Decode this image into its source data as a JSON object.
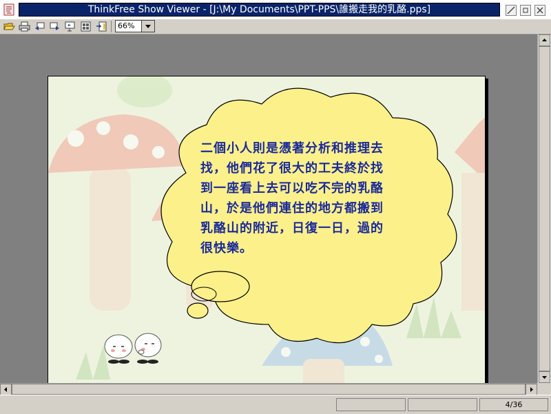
{
  "window": {
    "title": "ThinkFree Show Viewer - [J:\\My Documents\\PPT-PPS\\誰搬走我的乳酪.pps]",
    "controls": [
      "minimize",
      "maximize",
      "close"
    ]
  },
  "toolbar": {
    "buttons": [
      {
        "name": "open",
        "icon": "folder-open-icon"
      },
      {
        "name": "print",
        "icon": "printer-icon"
      },
      {
        "name": "previous-slide",
        "icon": "prev-slide-icon"
      },
      {
        "name": "next-slide",
        "icon": "next-slide-icon"
      },
      {
        "name": "slide-show",
        "icon": "slideshow-icon"
      },
      {
        "name": "slide-sorter",
        "icon": "sorter-icon"
      },
      {
        "name": "goto-slide",
        "icon": "goto-icon"
      }
    ],
    "zoom_value": "66%"
  },
  "slide": {
    "text": "二個小人則是憑著分析和推理去找，他們花了很大的工夫終於找到一座看上去可以吃不完的乳酪山，於是他們連住的地方都搬到乳酪山的附近，日復一日，過的很快樂。"
  },
  "status": {
    "page": "4/36"
  }
}
